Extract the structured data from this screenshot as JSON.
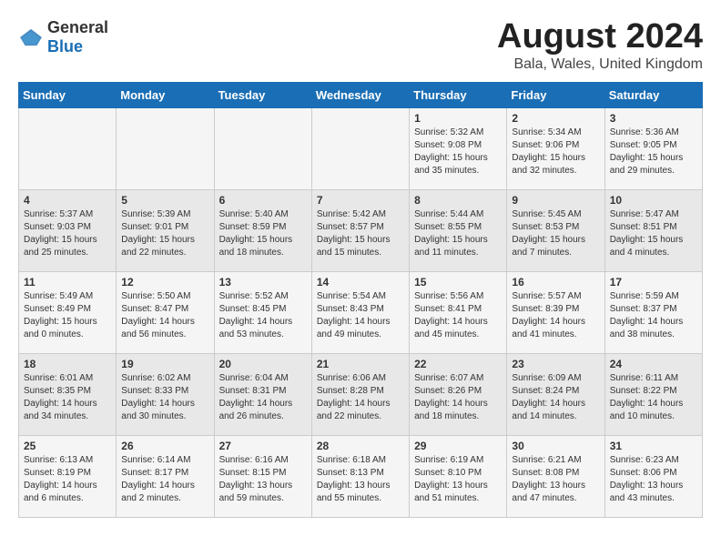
{
  "header": {
    "logo_general": "General",
    "logo_blue": "Blue",
    "month_title": "August 2024",
    "location": "Bala, Wales, United Kingdom"
  },
  "days_of_week": [
    "Sunday",
    "Monday",
    "Tuesday",
    "Wednesday",
    "Thursday",
    "Friday",
    "Saturday"
  ],
  "weeks": [
    [
      {
        "day": "",
        "content": ""
      },
      {
        "day": "",
        "content": ""
      },
      {
        "day": "",
        "content": ""
      },
      {
        "day": "",
        "content": ""
      },
      {
        "day": "1",
        "content": "Sunrise: 5:32 AM\nSunset: 9:08 PM\nDaylight: 15 hours\nand 35 minutes."
      },
      {
        "day": "2",
        "content": "Sunrise: 5:34 AM\nSunset: 9:06 PM\nDaylight: 15 hours\nand 32 minutes."
      },
      {
        "day": "3",
        "content": "Sunrise: 5:36 AM\nSunset: 9:05 PM\nDaylight: 15 hours\nand 29 minutes."
      }
    ],
    [
      {
        "day": "4",
        "content": "Sunrise: 5:37 AM\nSunset: 9:03 PM\nDaylight: 15 hours\nand 25 minutes."
      },
      {
        "day": "5",
        "content": "Sunrise: 5:39 AM\nSunset: 9:01 PM\nDaylight: 15 hours\nand 22 minutes."
      },
      {
        "day": "6",
        "content": "Sunrise: 5:40 AM\nSunset: 8:59 PM\nDaylight: 15 hours\nand 18 minutes."
      },
      {
        "day": "7",
        "content": "Sunrise: 5:42 AM\nSunset: 8:57 PM\nDaylight: 15 hours\nand 15 minutes."
      },
      {
        "day": "8",
        "content": "Sunrise: 5:44 AM\nSunset: 8:55 PM\nDaylight: 15 hours\nand 11 minutes."
      },
      {
        "day": "9",
        "content": "Sunrise: 5:45 AM\nSunset: 8:53 PM\nDaylight: 15 hours\nand 7 minutes."
      },
      {
        "day": "10",
        "content": "Sunrise: 5:47 AM\nSunset: 8:51 PM\nDaylight: 15 hours\nand 4 minutes."
      }
    ],
    [
      {
        "day": "11",
        "content": "Sunrise: 5:49 AM\nSunset: 8:49 PM\nDaylight: 15 hours\nand 0 minutes."
      },
      {
        "day": "12",
        "content": "Sunrise: 5:50 AM\nSunset: 8:47 PM\nDaylight: 14 hours\nand 56 minutes."
      },
      {
        "day": "13",
        "content": "Sunrise: 5:52 AM\nSunset: 8:45 PM\nDaylight: 14 hours\nand 53 minutes."
      },
      {
        "day": "14",
        "content": "Sunrise: 5:54 AM\nSunset: 8:43 PM\nDaylight: 14 hours\nand 49 minutes."
      },
      {
        "day": "15",
        "content": "Sunrise: 5:56 AM\nSunset: 8:41 PM\nDaylight: 14 hours\nand 45 minutes."
      },
      {
        "day": "16",
        "content": "Sunrise: 5:57 AM\nSunset: 8:39 PM\nDaylight: 14 hours\nand 41 minutes."
      },
      {
        "day": "17",
        "content": "Sunrise: 5:59 AM\nSunset: 8:37 PM\nDaylight: 14 hours\nand 38 minutes."
      }
    ],
    [
      {
        "day": "18",
        "content": "Sunrise: 6:01 AM\nSunset: 8:35 PM\nDaylight: 14 hours\nand 34 minutes."
      },
      {
        "day": "19",
        "content": "Sunrise: 6:02 AM\nSunset: 8:33 PM\nDaylight: 14 hours\nand 30 minutes."
      },
      {
        "day": "20",
        "content": "Sunrise: 6:04 AM\nSunset: 8:31 PM\nDaylight: 14 hours\nand 26 minutes."
      },
      {
        "day": "21",
        "content": "Sunrise: 6:06 AM\nSunset: 8:28 PM\nDaylight: 14 hours\nand 22 minutes."
      },
      {
        "day": "22",
        "content": "Sunrise: 6:07 AM\nSunset: 8:26 PM\nDaylight: 14 hours\nand 18 minutes."
      },
      {
        "day": "23",
        "content": "Sunrise: 6:09 AM\nSunset: 8:24 PM\nDaylight: 14 hours\nand 14 minutes."
      },
      {
        "day": "24",
        "content": "Sunrise: 6:11 AM\nSunset: 8:22 PM\nDaylight: 14 hours\nand 10 minutes."
      }
    ],
    [
      {
        "day": "25",
        "content": "Sunrise: 6:13 AM\nSunset: 8:19 PM\nDaylight: 14 hours\nand 6 minutes."
      },
      {
        "day": "26",
        "content": "Sunrise: 6:14 AM\nSunset: 8:17 PM\nDaylight: 14 hours\nand 2 minutes."
      },
      {
        "day": "27",
        "content": "Sunrise: 6:16 AM\nSunset: 8:15 PM\nDaylight: 13 hours\nand 59 minutes."
      },
      {
        "day": "28",
        "content": "Sunrise: 6:18 AM\nSunset: 8:13 PM\nDaylight: 13 hours\nand 55 minutes."
      },
      {
        "day": "29",
        "content": "Sunrise: 6:19 AM\nSunset: 8:10 PM\nDaylight: 13 hours\nand 51 minutes."
      },
      {
        "day": "30",
        "content": "Sunrise: 6:21 AM\nSunset: 8:08 PM\nDaylight: 13 hours\nand 47 minutes."
      },
      {
        "day": "31",
        "content": "Sunrise: 6:23 AM\nSunset: 8:06 PM\nDaylight: 13 hours\nand 43 minutes."
      }
    ]
  ]
}
